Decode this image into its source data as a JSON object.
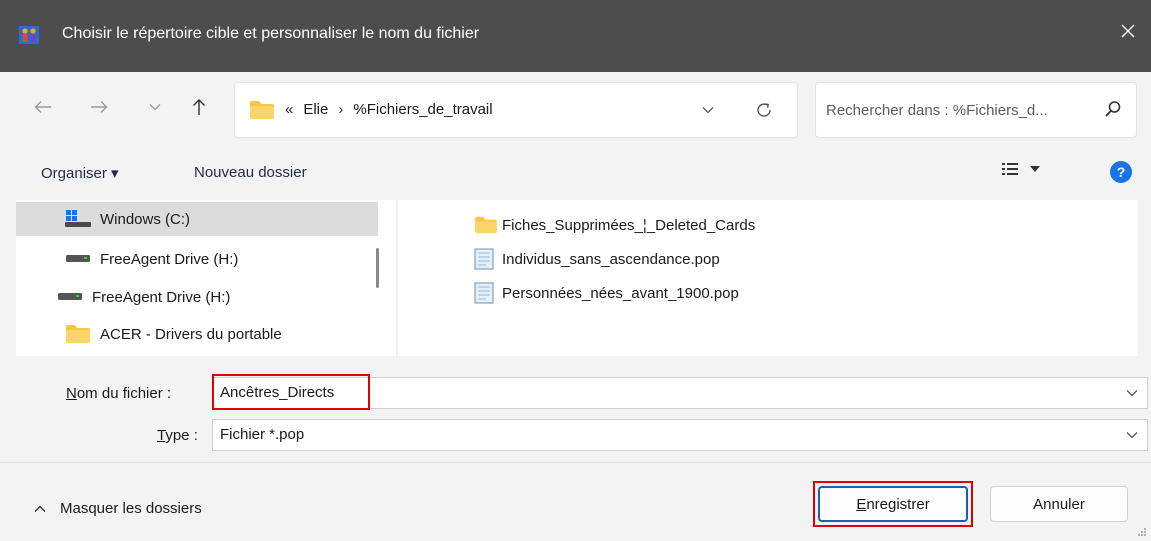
{
  "window": {
    "title": "Choisir le répertoire cible et personnaliser le nom du fichier",
    "close_glyph": "✕"
  },
  "nav": {
    "back_glyph": "←",
    "forward_glyph": "→",
    "recent_glyph": "⌄",
    "up_glyph": "↑"
  },
  "address": {
    "overflow_glyph": "«",
    "crumbs": [
      "Elie",
      "%Fichiers_de_travail"
    ],
    "separator": "›",
    "dropdown_glyph": "⌄",
    "refresh_glyph": "↻"
  },
  "search": {
    "placeholder": "Rechercher dans : %Fichiers_d...",
    "value": ""
  },
  "toolbar": {
    "organise_label": "Organiser ▾",
    "new_folder_label": "Nouveau dossier",
    "view_glyph": "☷",
    "view_dd_glyph": "▾",
    "help_glyph": "?"
  },
  "sidebar": {
    "items": [
      {
        "label": "Windows  (C:)",
        "icon": "windows-drive-icon",
        "selected": true
      },
      {
        "label": "FreeAgent Drive (H:)",
        "icon": "drive-icon",
        "selected": false
      },
      {
        "label": "FreeAgent Drive (H:)",
        "icon": "drive-icon",
        "selected": false
      },
      {
        "label": "ACER - Drivers du portable",
        "icon": "folder-icon",
        "selected": false
      }
    ]
  },
  "files": [
    {
      "name": "Fiches_Supprimées_¦_Deleted_Cards",
      "icon": "folder-icon"
    },
    {
      "name": "Individus_sans_ascendance.pop",
      "icon": "file-icon"
    },
    {
      "name": "Personnées_nées_avant_1900.pop",
      "icon": "file-icon"
    }
  ],
  "form": {
    "filename_label_accel": "N",
    "filename_label_rest": "om du fichier :",
    "filename_value": "Ancêtres_Directs",
    "type_label_accel": "T",
    "type_label_rest": "ype :",
    "type_value": "Fichier *.pop",
    "dropdown_glyph": "⌄"
  },
  "footer": {
    "hide_folders_glyph": "^",
    "hide_folders_label": "Masquer les dossiers",
    "save_accel": "E",
    "save_rest": "nregistrer",
    "cancel_label": "Annuler"
  },
  "colors": {
    "titlebar": "#4d4d4d",
    "folder": "#f8c646",
    "highlight": "#e00000",
    "primary_border": "#1a5fb4",
    "help": "#1a73e8"
  }
}
